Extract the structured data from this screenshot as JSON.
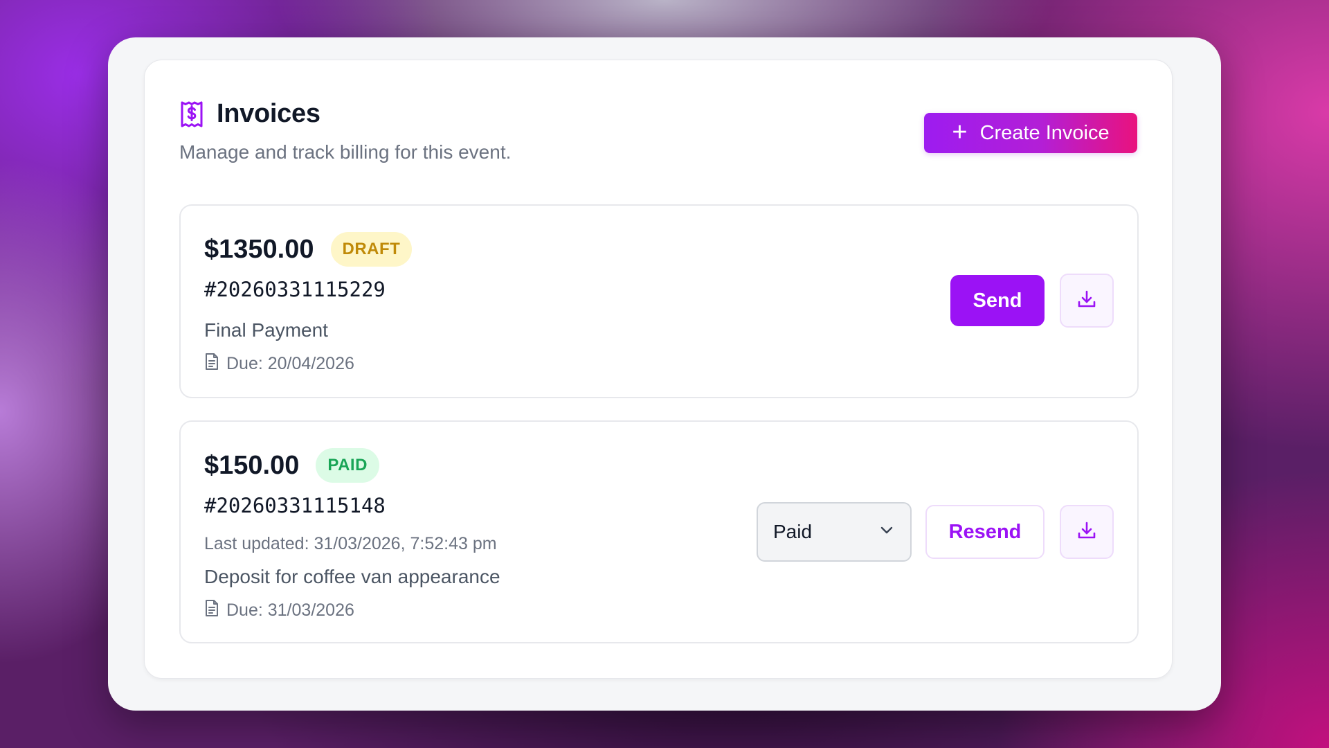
{
  "header": {
    "title": "Invoices",
    "subtitle": "Manage and track billing for this event.",
    "icon": "receipt-dollar-icon",
    "create_button_label": "Create Invoice"
  },
  "colors": {
    "accent": "#9b12f5",
    "gradient_end": "#e9127e",
    "draft_badge_bg": "#fef6c8",
    "draft_badge_text": "#c08a08",
    "paid_badge_bg": "#dcfbe6",
    "paid_badge_text": "#19a556"
  },
  "invoices": [
    {
      "amount": "$1350.00",
      "status": "DRAFT",
      "number": "#20260331115229",
      "description": "Final Payment",
      "due": "Due: 20/04/2026",
      "primary_action": "Send"
    },
    {
      "amount": "$150.00",
      "status": "PAID",
      "number": "#20260331115148",
      "last_updated": "Last updated: 31/03/2026, 7:52:43 pm",
      "description": "Deposit for coffee van appearance",
      "due": "Due: 31/03/2026",
      "status_select_value": "Paid",
      "primary_action": "Resend"
    }
  ]
}
